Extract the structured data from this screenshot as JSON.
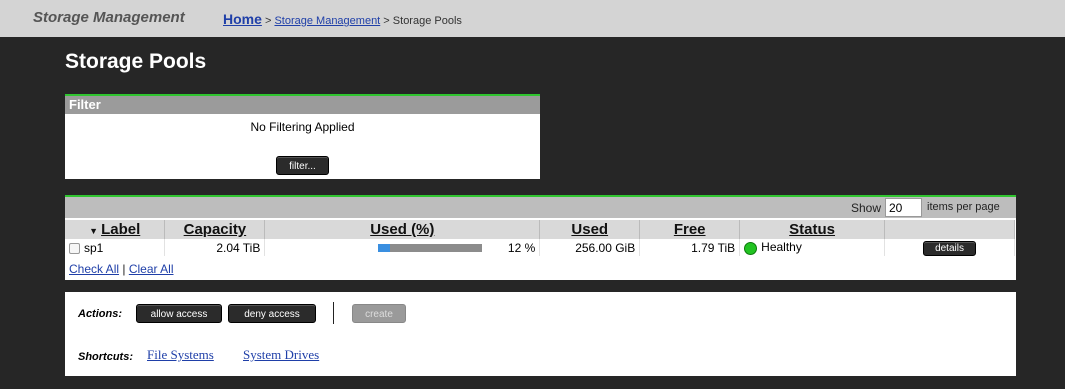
{
  "header": {
    "app_title": "Storage Management",
    "breadcrumb": {
      "home": "Home",
      "sep1": " > ",
      "crumb2": "Storage Management",
      "sep2": " > ",
      "current": "Storage Pools"
    }
  },
  "page_title": "Storage Pools",
  "filter": {
    "heading": "Filter",
    "message": "No Filtering Applied",
    "button_label": "filter..."
  },
  "table": {
    "show_label": "Show",
    "show_value": "20",
    "per_page_label": "items per page",
    "sort_indicator": "▼",
    "columns": [
      "Label",
      "Capacity",
      "Used (%)",
      "Used",
      "Free",
      "Status",
      ""
    ],
    "rows": [
      {
        "label": "sp1",
        "capacity": "2.04 TiB",
        "used_percent": 12,
        "used_percent_text": "12 %",
        "used": "256.00 GiB",
        "free": "1.79 TiB",
        "status": "Healthy",
        "details_label": "details"
      }
    ],
    "check_all": "Check All",
    "check_sep": " | ",
    "clear_all": "Clear All"
  },
  "actions": {
    "label": "Actions:",
    "allow_access": "allow access",
    "deny_access": "deny access",
    "create": "create"
  },
  "shortcuts": {
    "label": "Shortcuts:",
    "file_systems": "File Systems",
    "system_drives": "System Drives"
  },
  "colors": {
    "accent_green": "#2fc52f",
    "status_healthy": "#22c322",
    "usage_fill": "#3a8fe0",
    "link": "#1f3fa8"
  },
  "icons": {
    "status": "status-healthy-icon",
    "sort": "sort-descending-icon"
  }
}
